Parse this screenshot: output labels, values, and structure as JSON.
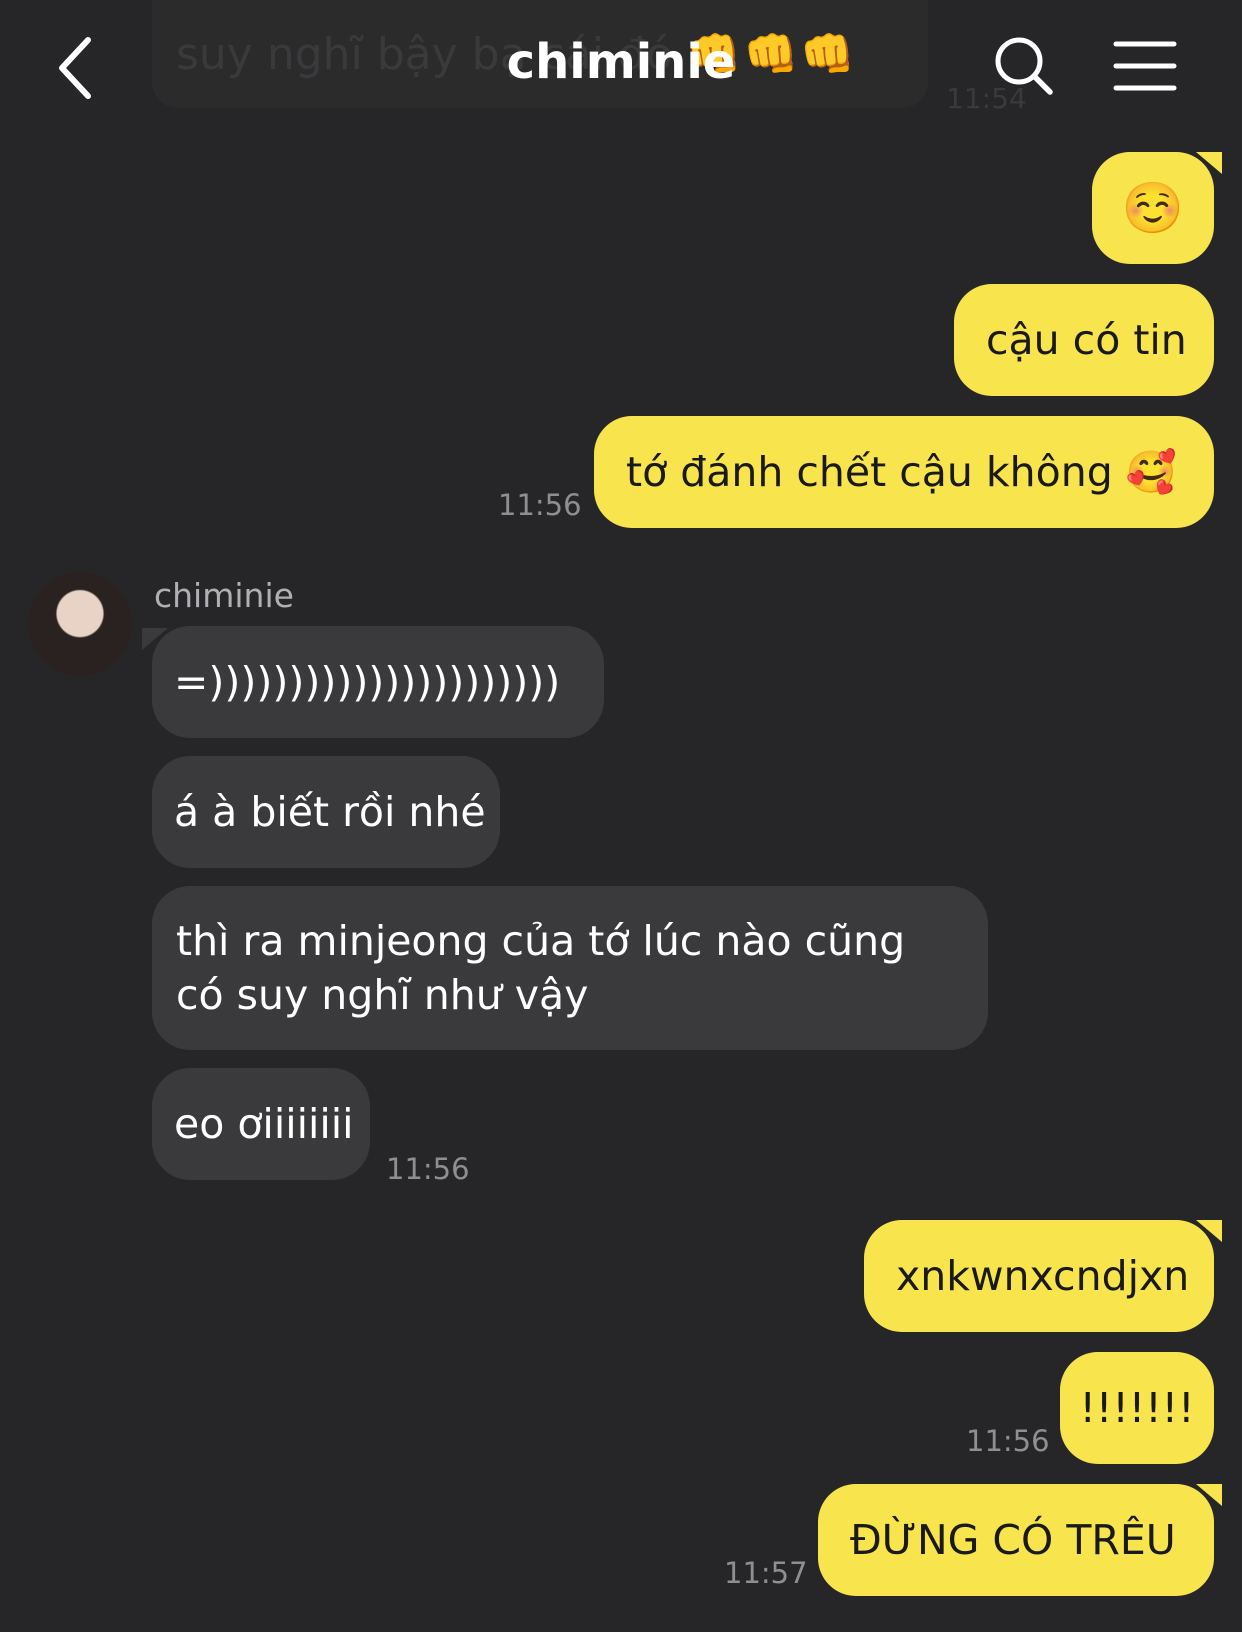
{
  "header": {
    "title": "chiminie",
    "back_icon": "chevron-left-icon",
    "search_icon": "search-icon",
    "menu_icon": "hamburger-menu-icon"
  },
  "ghost": {
    "text": "suy nghĩ bậy bạ cái đó",
    "emoji": "👊👊👊",
    "time": "11:54"
  },
  "messages": {
    "m1": "☺️",
    "m2": "cậu có tin",
    "m3": "tớ đánh chết cậu không 🥰",
    "t1": "11:56",
    "sender": "chiminie",
    "o1": "=))))))))))))))))))))))",
    "o2": "á à biết rồi nhé",
    "o3": "thì ra minjeong của tớ lúc nào cũng có suy nghĩ như vậy",
    "o4": "eo ơiiiiiiii",
    "t2": "11:56",
    "m4": "xnkwnxcndjxn",
    "m5": "!!!!!!!",
    "t3": "11:56",
    "m6": "ĐỪNG CÓ TRÊU",
    "t4": "11:57"
  },
  "colors": {
    "background": "#262628",
    "my_bubble": "#f8e54d",
    "their_bubble": "#3a3a3c",
    "timestamp": "#8e8e93"
  }
}
